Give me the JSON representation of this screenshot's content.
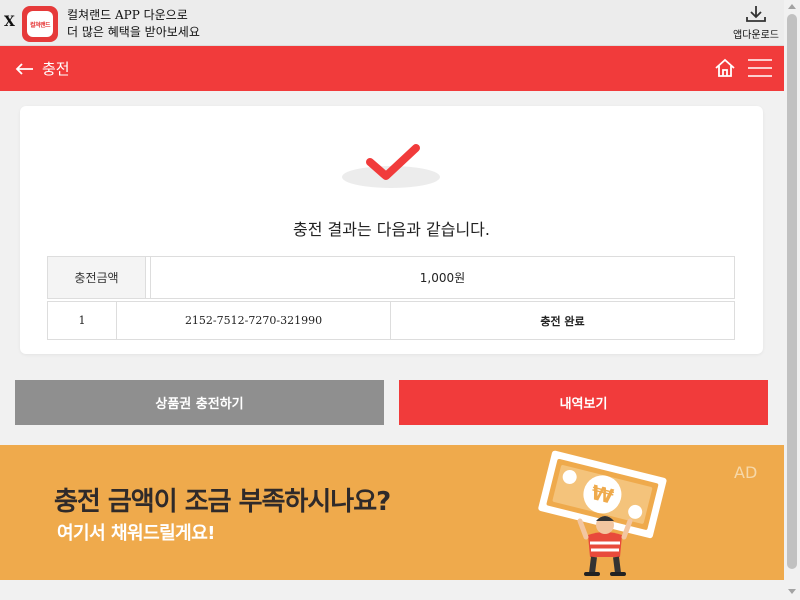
{
  "app_banner": {
    "close_label": "X",
    "logo_text": "컬쳐랜드",
    "line1": "컬쳐랜드 APP 다운으로",
    "line2": "더 많은 혜택을 받아보세요",
    "download_label": "앱다운로드"
  },
  "header": {
    "title": "충전",
    "accent_color": "#f13b3b"
  },
  "result": {
    "message": "충전 결과는 다음과 같습니다.",
    "amount_label": "충전금액",
    "amount_value": "1,000원",
    "rows": [
      {
        "index": "1",
        "code": "2152-7512-7270-321990",
        "status": "충전 완료"
      }
    ]
  },
  "actions": {
    "gift_button": "상품권 충전하기",
    "history_button": "내역보기"
  },
  "ad": {
    "label": "AD",
    "headline": "충전 금액이 조금 부족하시나요?",
    "subline": "여기서 채워드릴게요!",
    "background": "#efaa4c"
  },
  "icons": [
    "close-icon",
    "app-logo",
    "download-icon",
    "back-arrow-icon",
    "home-icon",
    "menu-icon",
    "check-icon",
    "won-icon"
  ]
}
